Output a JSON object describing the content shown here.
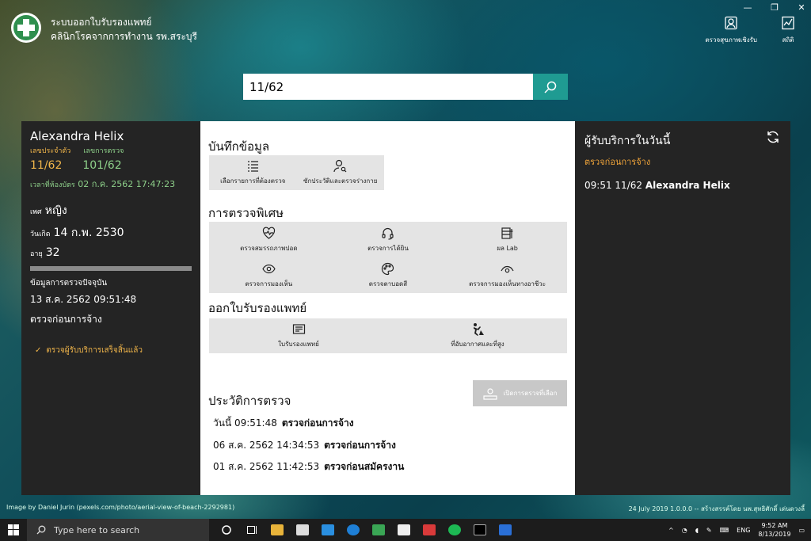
{
  "app": {
    "title_line1": "ระบบออกใบรับรองแพทย์",
    "title_line2": "คลินิกโรคจากการทำงาน รพ.สระบุรี"
  },
  "top_actions": [
    {
      "label": "ตรวจสุขภาพเชิงรับ",
      "icon": "person-frame-icon"
    },
    {
      "label": "สถิติ",
      "icon": "chart-icon"
    }
  ],
  "search": {
    "value": "11/62"
  },
  "patient": {
    "name": "Alexandra Helix",
    "id_label": "เลขประจำตัว",
    "visit_label": "เลขการตรวจ",
    "id_value": "11/62",
    "visit_value": "101/62",
    "checkin_label": "เวลาที่ห้องบัตร",
    "checkin_value": "02 ก.ค. 2562 17:47:23",
    "sex_label": "เพศ",
    "sex_value": "หญิง",
    "dob_label": "วันเกิด",
    "dob_value": "14 ก.พ. 2530",
    "age_label": "อายุ",
    "age_value": "32",
    "progress": 1.0,
    "current_label": "ข้อมูลการตรวจปัจจุบัน",
    "current_datetime": "13 ส.ค. 2562 09:51:48",
    "current_type": "ตรวจก่อนการจ้าง",
    "done_text": "ตรวจผู้รับบริการเสร็จสิ้นแล้ว"
  },
  "record": {
    "title": "บันทึกข้อมูล",
    "buttons": [
      {
        "label": "เลือกรายการที่ต้องตรวจ",
        "icon": "checklist-icon"
      },
      {
        "label": "ซักประวัติและตรวจร่างกาย",
        "icon": "person-search-icon"
      }
    ]
  },
  "special": {
    "title": "การตรวจพิเศษ",
    "buttons": [
      {
        "label": "ตรวจสมรรถภาพปอด",
        "icon": "heart-pulse-icon"
      },
      {
        "label": "ตรวจการได้ยิน",
        "icon": "headset-icon"
      },
      {
        "label": "ผล Lab",
        "icon": "lab-icon"
      },
      {
        "label": "ตรวจการมองเห็น",
        "icon": "eye-icon"
      },
      {
        "label": "ตรวจตาบอดสี",
        "icon": "palette-icon"
      },
      {
        "label": "ตรวจการมองเห็นทางอาชีวะ",
        "icon": "eye-half-icon"
      }
    ]
  },
  "certificate": {
    "title": "ออกใบรับรองแพทย์",
    "buttons": [
      {
        "label": "ใบรับรองแพทย์",
        "icon": "certificate-icon"
      },
      {
        "label": "ที่อับอากาศและที่สูง",
        "icon": "worker-icon"
      }
    ]
  },
  "history": {
    "title": "ประวัติการตรวจ",
    "open_button": "เปิดการตรวจที่เลือก",
    "rows": [
      {
        "date": "วันนี้ 09:51:48",
        "type": "ตรวจก่อนการจ้าง"
      },
      {
        "date": "06 ส.ค. 2562 14:34:53",
        "type": "ตรวจก่อนการจ้าง"
      },
      {
        "date": "01 ส.ค. 2562 11:42:53",
        "type": "ตรวจก่อนสมัครงาน"
      }
    ]
  },
  "today": {
    "title": "ผู้รับบริการในวันนี้",
    "subtitle": "ตรวจก่อนการจ้าง",
    "entries": [
      {
        "time": "09:51",
        "id": "11/62",
        "name": "Alexandra Helix"
      }
    ]
  },
  "footer": {
    "credit": "Image by Daniel Jurin (pexels.com/photo/aerial-view-of-beach-2292981)",
    "version": "24 July 2019 1.0.0.0 -- สร้างสรรค์โดย นพ.สุทธิศักดิ์ เด่นดวงลี้"
  },
  "taskbar": {
    "search_placeholder": "Type here to search",
    "lang": "ENG",
    "time": "9:52 AM",
    "date": "8/13/2019"
  },
  "colors": {
    "accent": "#1f9b92",
    "orange": "#f0a43a",
    "green": "#8ed08a",
    "panel": "#242424"
  }
}
